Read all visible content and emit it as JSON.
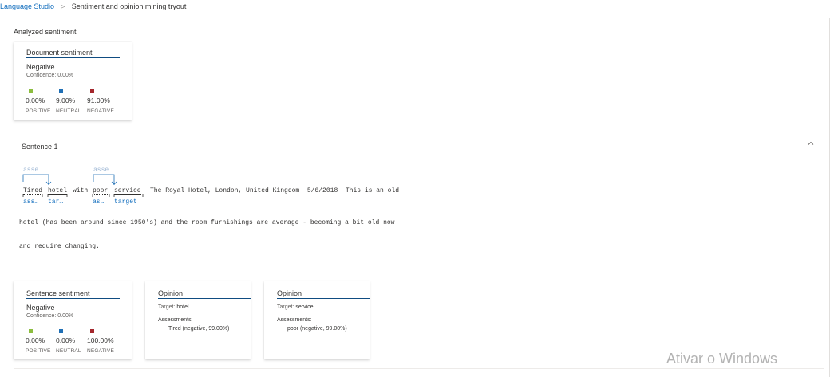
{
  "breadcrumb": {
    "root": "Language Studio",
    "separator": ">",
    "current": "Sentiment and opinion mining tryout"
  },
  "analyzed": {
    "title": "Analyzed sentiment",
    "document_card": {
      "title": "Document sentiment",
      "sentiment": "Negative",
      "confidence": "Confidence: 0.00%",
      "scores": [
        {
          "value": "0.00%",
          "label": "POSITIVE",
          "color": "#8cbd3f"
        },
        {
          "value": "9.00%",
          "label": "NEUTRAL",
          "color": "#1f6fb5"
        },
        {
          "value": "91.00%",
          "label": "NEGATIVE",
          "color": "#a4262c"
        }
      ]
    }
  },
  "sentence": {
    "title": "Sentence 1",
    "tokens": {
      "tired": "Tired",
      "hotel": "hotel",
      "with": "with",
      "poor": "poor",
      "service": "service"
    },
    "rest_line1": "The Royal Hotel, London, United Kingdom  5/6/2018  This is an old",
    "line2": "hotel (has been around since 1950's) and the room furnishings are average - becoming a bit old now",
    "line3": "and require changing.",
    "above_tags": [
      "asse…",
      "asse…"
    ],
    "below_tags": [
      "ass…",
      "tar…",
      "as…",
      "target"
    ],
    "sentiment_card": {
      "title": "Sentence sentiment",
      "sentiment": "Negative",
      "confidence": "Confidence: 0.00%",
      "scores": [
        {
          "value": "0.00%",
          "label": "POSITIVE",
          "color": "#8cbd3f"
        },
        {
          "value": "0.00%",
          "label": "NEUTRAL",
          "color": "#1f6fb5"
        },
        {
          "value": "100.00%",
          "label": "NEGATIVE",
          "color": "#a4262c"
        }
      ]
    },
    "opinions": [
      {
        "title": "Opinion",
        "target_label": "Target:",
        "target": "hotel",
        "assessments_label": "Assessments:",
        "assessment": "Tired (negative, 99.00%)"
      },
      {
        "title": "Opinion",
        "target_label": "Target:",
        "target": "service",
        "assessments_label": "Assessments:",
        "assessment": "poor (negative, 99.00%)"
      }
    ]
  },
  "watermark": "Ativar o Windows",
  "icons": {
    "chevron": "chevron-up-icon",
    "separator": "chevron-right-icon"
  }
}
